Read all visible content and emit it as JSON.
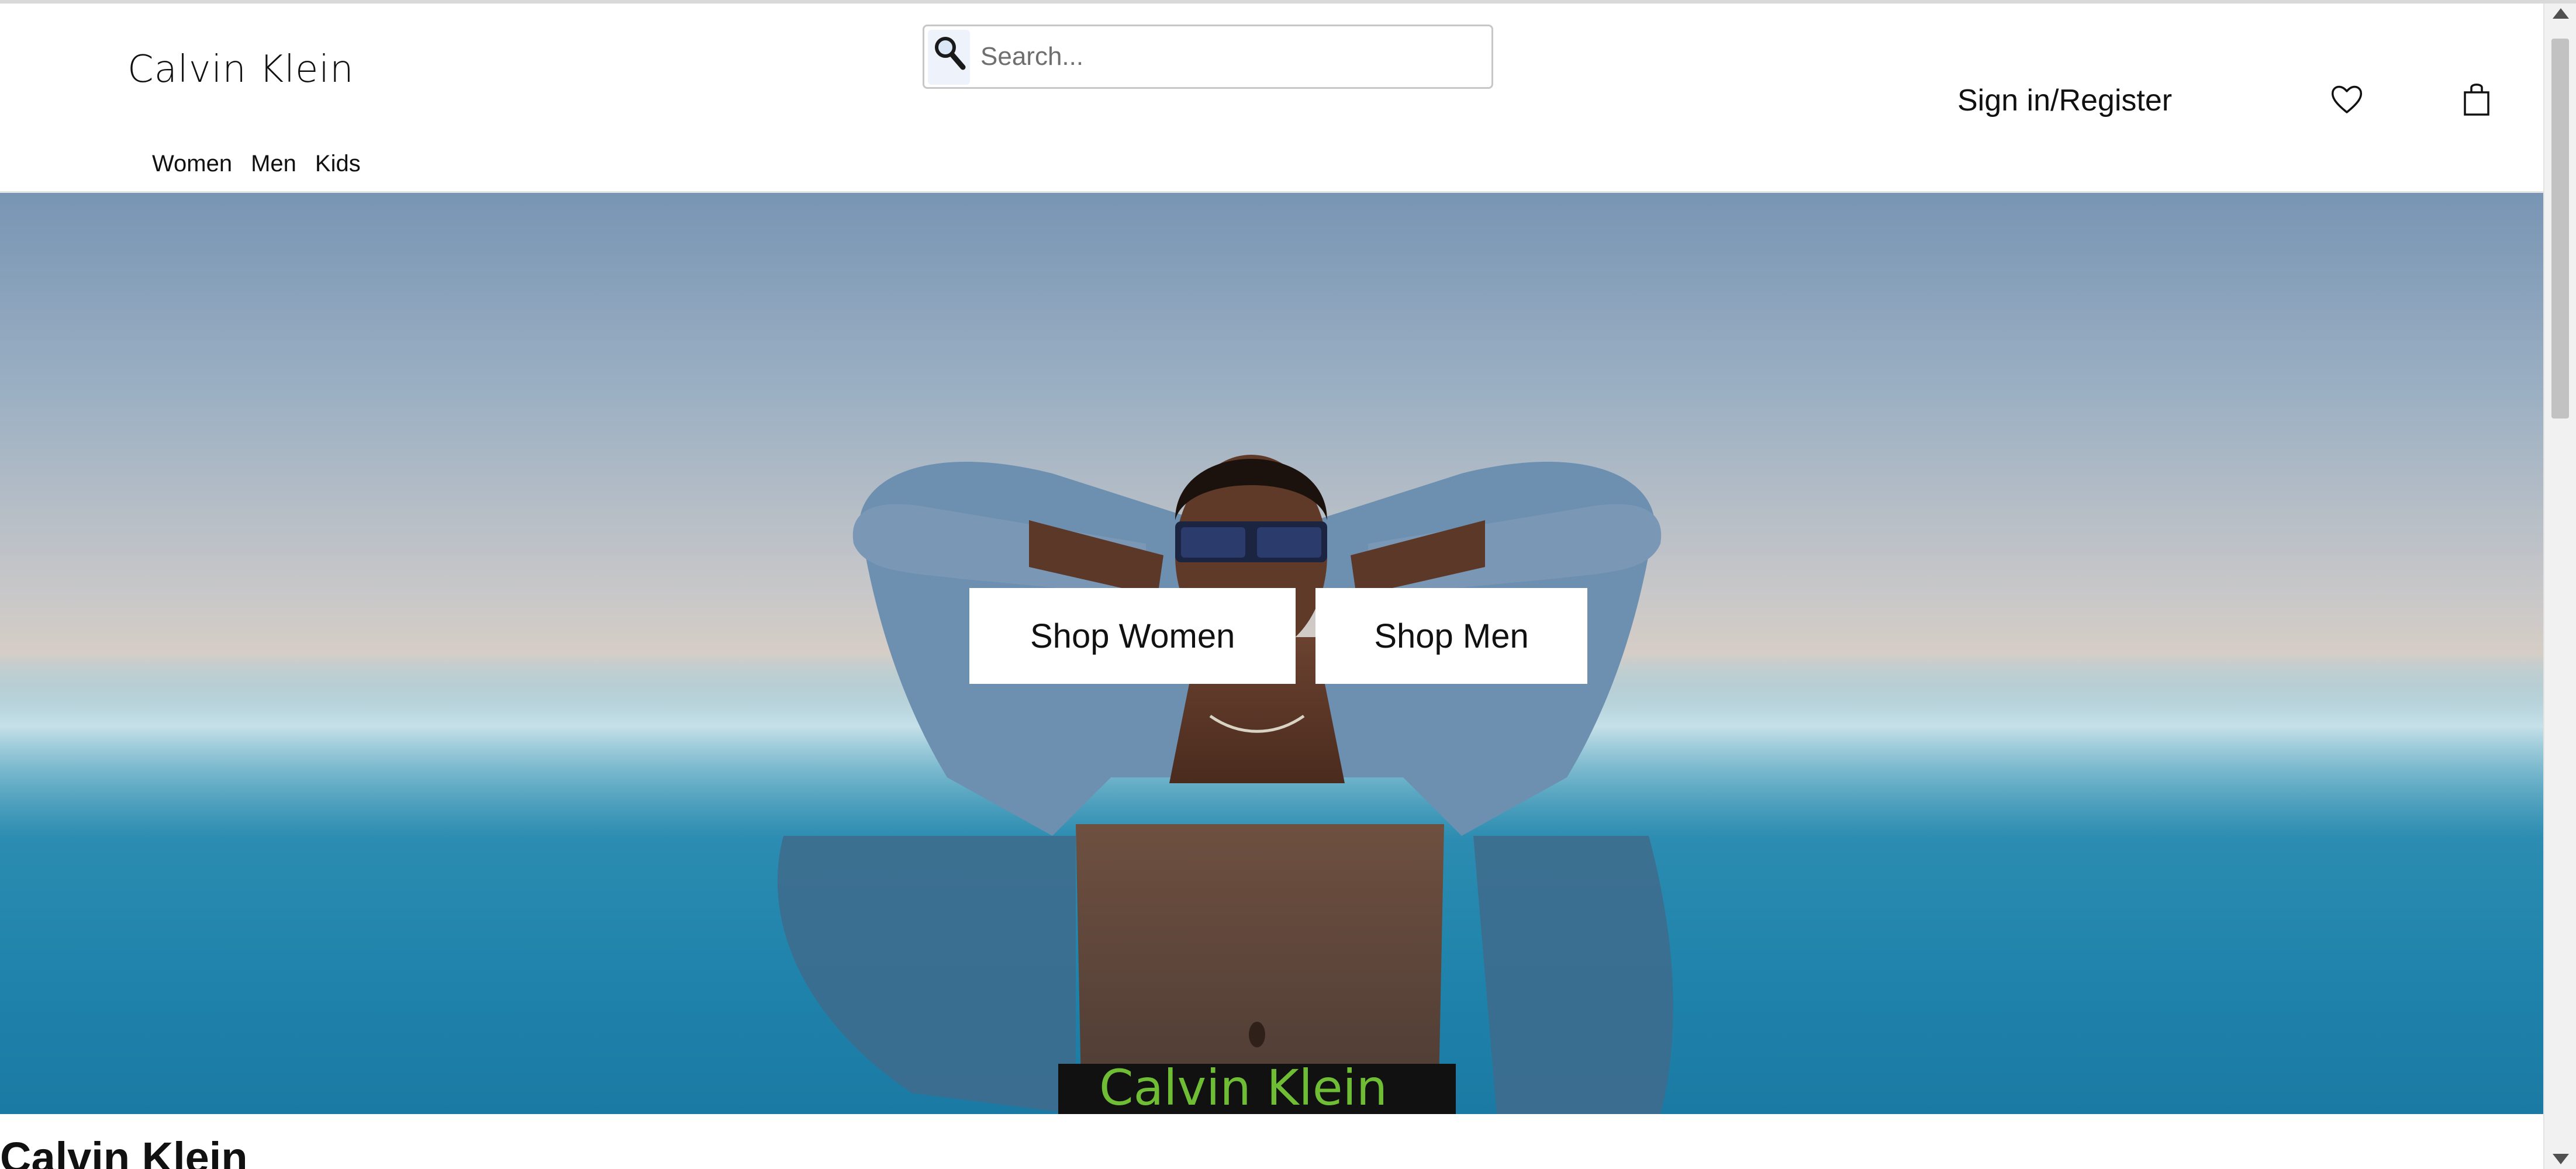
{
  "header": {
    "logo_text": "Calvin Klein",
    "search": {
      "placeholder": "Search...",
      "value": "",
      "icon": "search-icon"
    },
    "account_link": "Sign in/Register",
    "wishlist_icon": "heart-icon",
    "bag_icon": "shopping-bag-icon"
  },
  "nav": {
    "items": [
      {
        "label": "Women"
      },
      {
        "label": "Men"
      },
      {
        "label": "Kids"
      }
    ]
  },
  "hero": {
    "image_description": "Man in denim shirt and sunglasses standing half-submerged in water",
    "buttons": [
      {
        "label": "Shop Women"
      },
      {
        "label": "Shop Men"
      }
    ]
  },
  "section": {
    "heading": "Calvin Klein"
  },
  "colors": {
    "accent": "#111111",
    "water": "#1f83ab",
    "sky": "#7895b4"
  }
}
